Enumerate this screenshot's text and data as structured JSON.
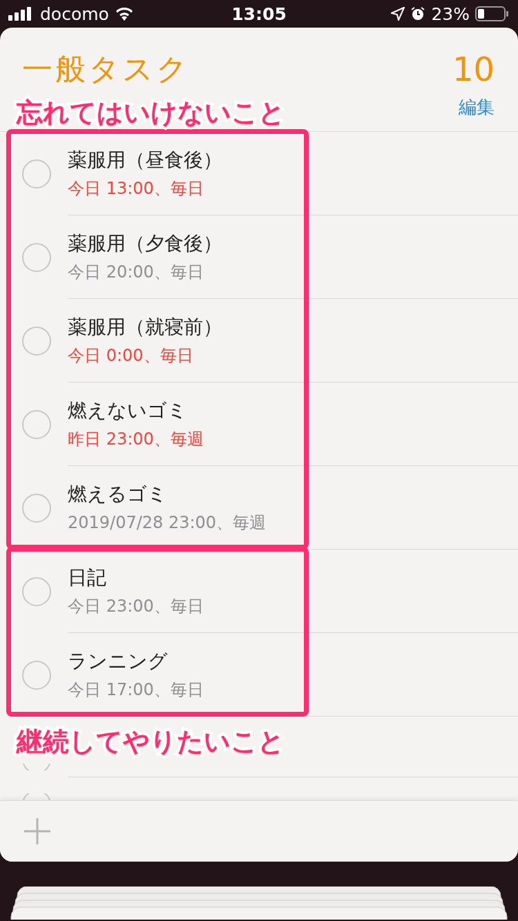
{
  "status_bar": {
    "carrier": "docomo",
    "time": "13:05",
    "battery": "23%"
  },
  "list": {
    "title": "一般タスク",
    "count": "10",
    "edit": "編集"
  },
  "sections": [
    {
      "annotation": "忘れてはいけないこと",
      "rows": [
        {
          "title": "薬服用（昼食後）",
          "due": "今日 13:00、毎日",
          "overdue": true,
          "checked": false
        },
        {
          "title": "薬服用（夕食後）",
          "due": "今日 20:00、毎日",
          "overdue": false,
          "checked": false
        },
        {
          "title": "薬服用（就寝前）",
          "due": "今日 0:00、毎日",
          "overdue": true,
          "checked": false
        },
        {
          "title": "燃えないゴミ",
          "due": "昨日 23:00、毎週",
          "overdue": true,
          "checked": false
        },
        {
          "title": "燃えるゴミ",
          "due": "2019/07/28 23:00、毎週",
          "overdue": false,
          "checked": false
        }
      ]
    },
    {
      "annotation": "継続してやりたいこと",
      "rows": [
        {
          "title": "日記",
          "due": "今日 23:00、毎日",
          "overdue": false,
          "checked": false
        },
        {
          "title": "ランニング",
          "due": "今日 17:00、毎日",
          "overdue": false,
          "checked": false
        }
      ]
    },
    {
      "rows": [
        {
          "checked": false,
          "covered": true
        },
        {
          "checked": false,
          "cut_off": true
        }
      ]
    }
  ]
}
